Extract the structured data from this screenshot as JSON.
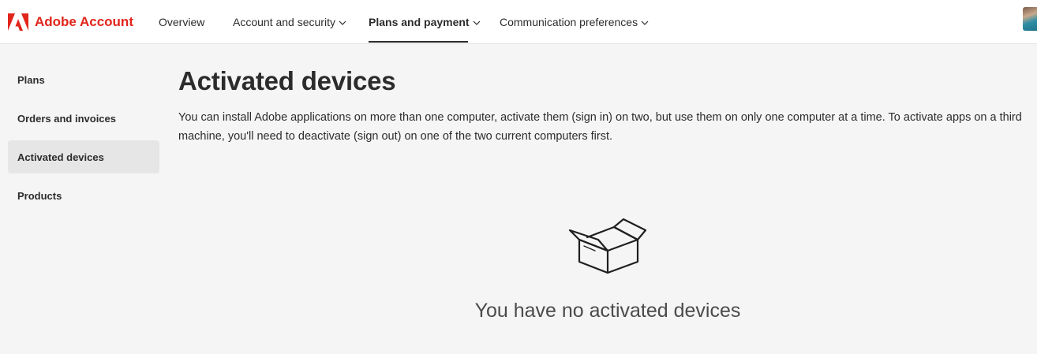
{
  "header": {
    "brand": "Adobe Account",
    "nav": [
      {
        "label": "Overview"
      },
      {
        "label": "Account and security"
      },
      {
        "label": "Plans and payment"
      },
      {
        "label": "Communication preferences"
      }
    ],
    "active_nav": "Plans and payment",
    "brand_color": "#e1251b"
  },
  "sidebar": {
    "items": [
      {
        "label": "Plans"
      },
      {
        "label": "Orders and invoices"
      },
      {
        "label": "Activated devices"
      },
      {
        "label": "Products"
      }
    ],
    "active_item": "Activated devices"
  },
  "main": {
    "title": "Activated devices",
    "description": "You can install Adobe applications on more than one computer, activate them (sign in) on two, but use them on only one computer at a time. To activate apps on a third machine, you'll need to deactivate (sign out) on one of the two current computers first.",
    "empty_state": {
      "icon": "empty-box-icon",
      "message": "You have no activated devices"
    }
  },
  "icons": {
    "logo": "adobe-logo-icon",
    "chevron": "chevron-down-icon",
    "avatar": "user-avatar"
  }
}
